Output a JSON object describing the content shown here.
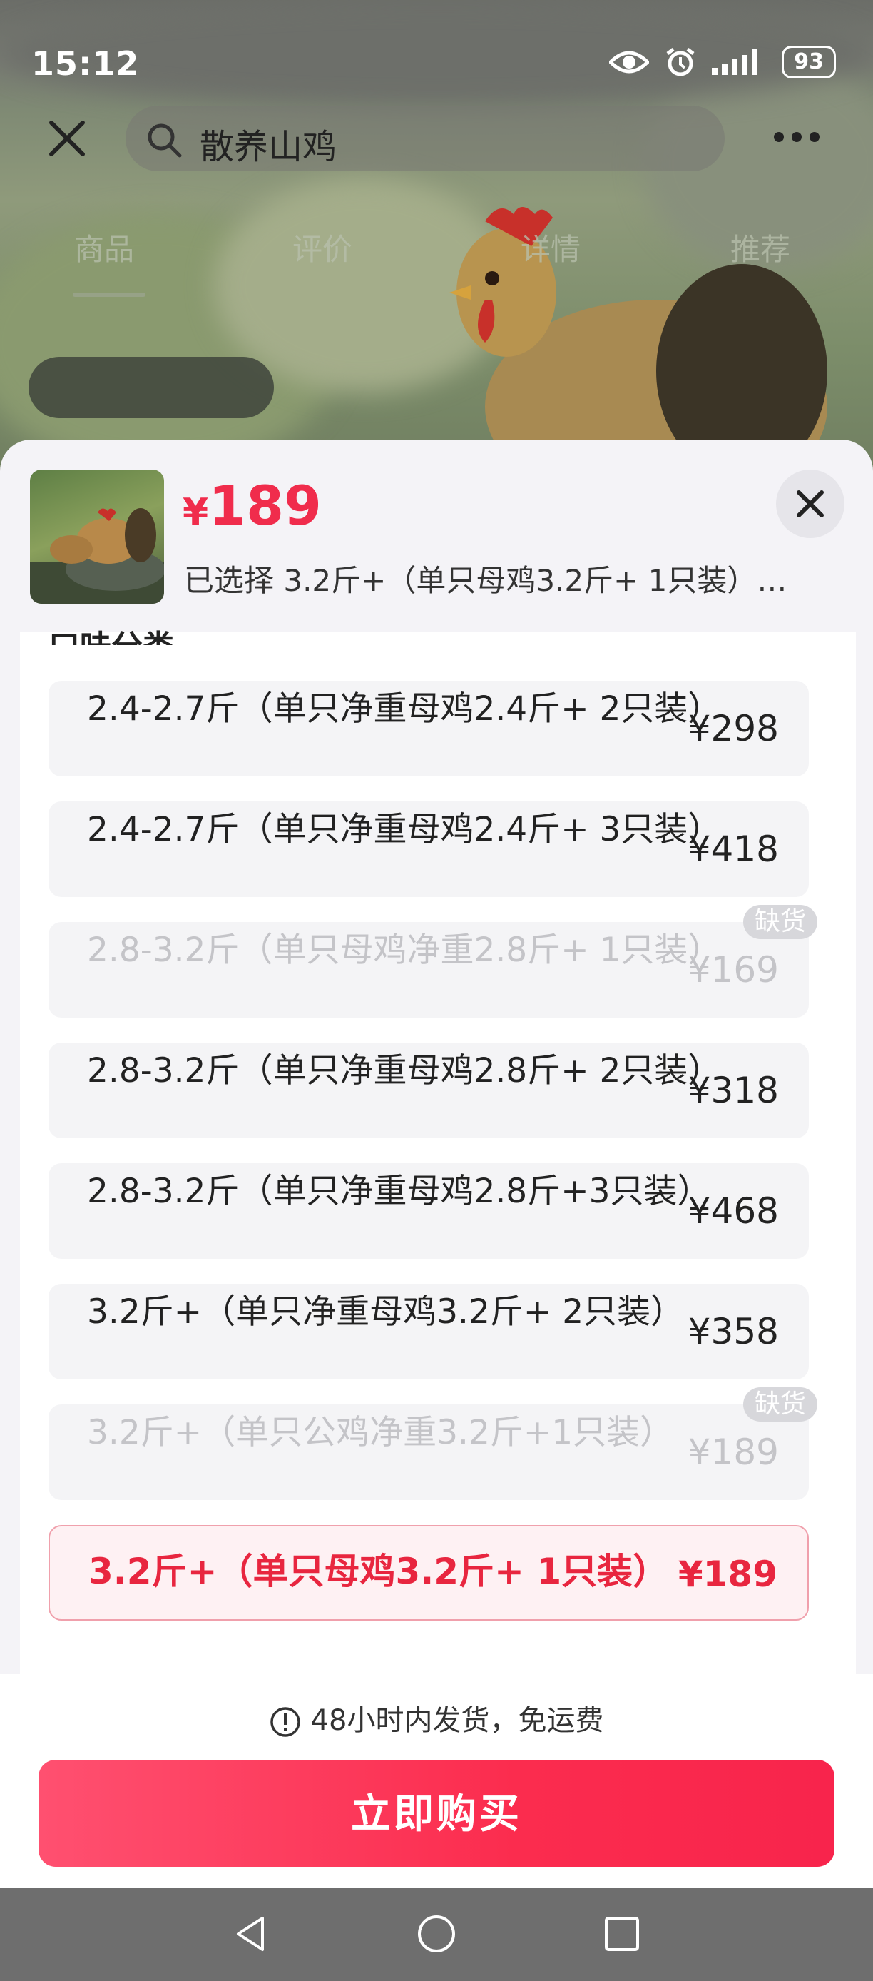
{
  "status_bar": {
    "time": "15:12",
    "battery": "93"
  },
  "header": {
    "search_text": "散养山鸡"
  },
  "tabs": [
    "商品",
    "评价",
    "详情",
    "推荐"
  ],
  "sheet": {
    "price_symbol": "¥",
    "price_value": "189",
    "selected_text": "已选择  3.2斤+（单只母鸡3.2斤+ 1只装）…",
    "section_title": "口味分类"
  },
  "options": [
    {
      "label": "2.4-2.7斤（单只净重母鸡2.4斤+ 2只装）",
      "price": "¥298",
      "state": "normal",
      "badge": ""
    },
    {
      "label": "2.4-2.7斤（单只净重母鸡2.4斤+ 3只装）",
      "price": "¥418",
      "state": "normal",
      "badge": ""
    },
    {
      "label": "2.8-3.2斤（单只母鸡净重2.8斤+ 1只装）",
      "price": "¥169",
      "state": "disabled",
      "badge": "缺货"
    },
    {
      "label": "2.8-3.2斤（单只净重母鸡2.8斤+ 2只装）",
      "price": "¥318",
      "state": "normal",
      "badge": ""
    },
    {
      "label": "2.8-3.2斤（单只净重母鸡2.8斤+3只装）",
      "price": "¥468",
      "state": "normal",
      "badge": ""
    },
    {
      "label": "3.2斤+（单只净重母鸡3.2斤+ 2只装）",
      "price": "¥358",
      "state": "normal",
      "badge": ""
    },
    {
      "label": "3.2斤+（单只公鸡净重3.2斤+1只装）",
      "price": "¥189",
      "state": "disabled",
      "badge": "缺货"
    },
    {
      "label": "3.2斤+（单只母鸡3.2斤+ 1只装）",
      "price": "¥189",
      "state": "selected",
      "badge": ""
    }
  ],
  "footer": {
    "notice": "48小时内发货，免运费",
    "buy_label": "立即购买"
  },
  "colors": {
    "accent": "#f02c4c",
    "buy_start": "#ff5070",
    "buy_end": "#f8244c"
  }
}
